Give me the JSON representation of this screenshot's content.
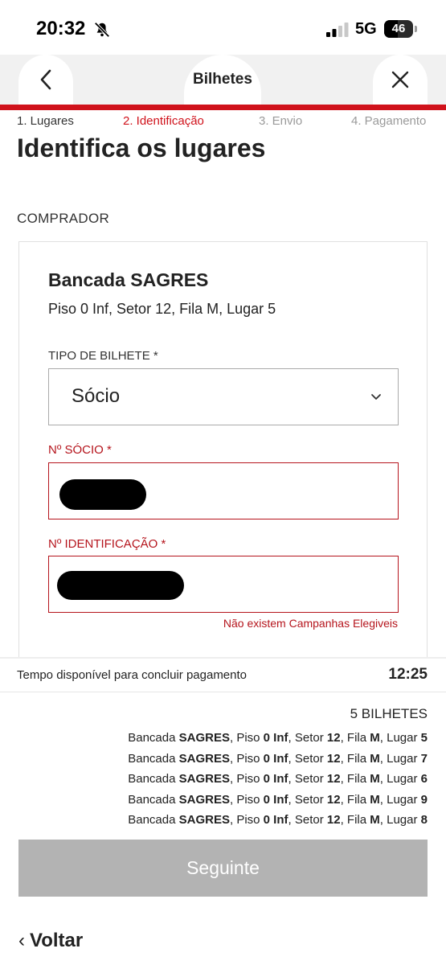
{
  "status_bar": {
    "time": "20:32",
    "network": "5G",
    "battery": "46",
    "battery_level": 0.46
  },
  "header": {
    "title": "Bilhetes"
  },
  "steps": [
    "1. Lugares",
    "2. Identificação",
    "3. Envio",
    "4. Pagamento"
  ],
  "page_title": "Identifica os lugares",
  "section_label": "COMPRADOR",
  "card": {
    "title": "Bancada SAGRES",
    "subtitle": "Piso 0 Inf, Setor 12, Fila M, Lugar 5",
    "ticket_type_label": "TIPO DE BILHETE *",
    "ticket_type_value": "Sócio",
    "member_label": "Nº SÓCIO *",
    "id_label": "Nº IDENTIFICAÇÃO *",
    "error": "Não existem Campanhas Elegiveis"
  },
  "timer": {
    "label": "Tempo disponível para concluir pagamento",
    "value": "12:25"
  },
  "tickets_count": "5 BILHETES",
  "ticket_words": {
    "stand": "Bancada",
    "floor": "Piso",
    "sector": "Setor",
    "row": "Fila",
    "seat": "Lugar"
  },
  "tickets": [
    {
      "stand": "SAGRES",
      "floor": "0 Inf",
      "sector": "12",
      "row": "M",
      "seat": "5"
    },
    {
      "stand": "SAGRES",
      "floor": "0 Inf",
      "sector": "12",
      "row": "M",
      "seat": "7"
    },
    {
      "stand": "SAGRES",
      "floor": "0 Inf",
      "sector": "12",
      "row": "M",
      "seat": "6"
    },
    {
      "stand": "SAGRES",
      "floor": "0 Inf",
      "sector": "12",
      "row": "M",
      "seat": "9"
    },
    {
      "stand": "SAGRES",
      "floor": "0 Inf",
      "sector": "12",
      "row": "M",
      "seat": "8"
    }
  ],
  "buttons": {
    "next": "Seguinte",
    "back": "Voltar"
  },
  "colors": {
    "accent": "#d0121b",
    "error": "#b5141c",
    "disabled_button": "#b3b3b3"
  }
}
